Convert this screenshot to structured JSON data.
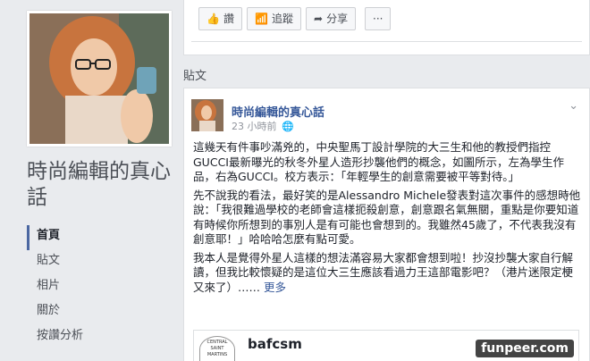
{
  "sidebar": {
    "page_name": "時尚編輯的真心話",
    "nav": [
      {
        "label": "首頁",
        "active": true
      },
      {
        "label": "貼文",
        "active": false
      },
      {
        "label": "相片",
        "active": false
      },
      {
        "label": "關於",
        "active": false
      },
      {
        "label": "按讚分析",
        "active": false
      }
    ]
  },
  "actions": {
    "like_label": "讚",
    "follow_label": "追蹤",
    "share_label": "分享",
    "more_label": "···"
  },
  "section_label": "貼文",
  "post": {
    "author": "時尚編輯的真心話",
    "time": "23 小時前",
    "menu": "⌄",
    "paragraphs": [
      "這幾天有件事吵滿兇的，中央聖馬丁設計學院的大三生和他的教授們指控GUCCI最新曝光的秋冬外星人造形抄襲他們的概念，如圖所示，左為學生作品，右為GUCCI。校方表示：「年輕學生的創意需要被平等對待。」",
      "先不說我的看法，最好笑的是Alessandro Michele發表對這次事件的感想時他說：「我很難過學校的老師會這樣扼殺創意，創意跟名氣無關，重點是你要知道有時候你所想到的事別人是有可能也會想到的。我雖然45歲了，不代表我沒有創意耶！」哈哈哈怎麼有點可愛。",
      "我本人是覺得外星人這樣的想法滿容易大家都會想到啦！抄沒抄襲大家自行解讀，但我比較懷疑的是這位大三生應該看過力王這部電影吧？（港片迷限定梗又來了）……"
    ],
    "more_link": "更多",
    "shared": {
      "logo_text": "CENTRAL SAINT MARTINS",
      "name": "bafcsm"
    }
  },
  "watermark": "funpeer.com",
  "colors": {
    "background": "#e9ebee",
    "link": "#365899",
    "nav_active_bar": "#4b67a1"
  }
}
